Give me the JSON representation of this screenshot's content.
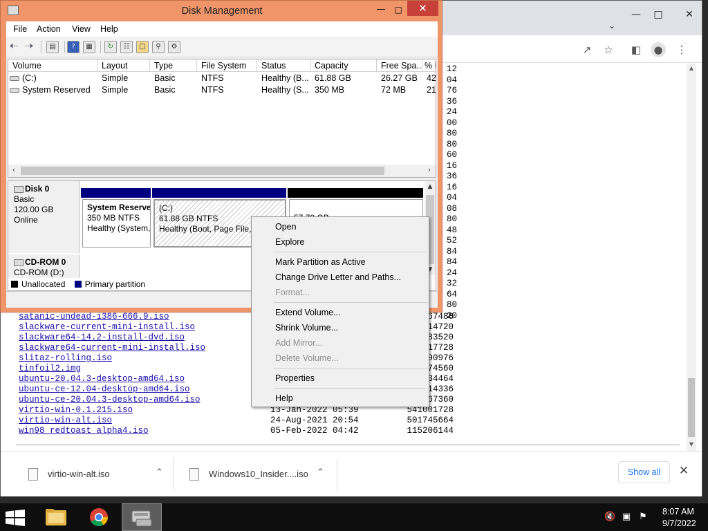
{
  "disk_management": {
    "title": "Disk Management",
    "menu": [
      "File",
      "Action",
      "View",
      "Help"
    ],
    "columns": [
      "Volume",
      "Layout",
      "Type",
      "File System",
      "Status",
      "Capacity",
      "Free Spa...",
      "% F"
    ],
    "volumes": [
      {
        "volume": "(C:)",
        "layout": "Simple",
        "type": "Basic",
        "fs": "NTFS",
        "status": "Healthy (B...",
        "capacity": "61.88 GB",
        "free": "26.27 GB",
        "pct": "42"
      },
      {
        "volume": "System Reserved",
        "layout": "Simple",
        "type": "Basic",
        "fs": "NTFS",
        "status": "Healthy (S...",
        "capacity": "350 MB",
        "free": "72 MB",
        "pct": "21"
      }
    ],
    "disk0": {
      "name": "Disk 0",
      "kind": "Basic",
      "size": "120.00 GB",
      "state": "Online",
      "partitions": [
        {
          "name": "System Reserve",
          "size": "350 MB NTFS",
          "status": "Healthy (System,"
        },
        {
          "name": "(C:)",
          "size": "61.88 GB NTFS",
          "status": "Healthy (Boot, Page File, P"
        },
        {
          "name": "",
          "size": "57.78 GB",
          "status": ""
        }
      ]
    },
    "cdrom": {
      "name": "CD-ROM 0",
      "label": "CD-ROM (D:)"
    },
    "legend": {
      "unallocated": "Unallocated",
      "primary": "Primary partition"
    },
    "colors": {
      "primary": "#000080",
      "unallocated": "#000000"
    }
  },
  "context_menu": {
    "items": [
      {
        "label": "Open",
        "enabled": true
      },
      {
        "label": "Explore",
        "enabled": true
      },
      {
        "label": "Mark Partition as Active",
        "enabled": true
      },
      {
        "label": "Change Drive Letter and Paths...",
        "enabled": true
      },
      {
        "label": "Format...",
        "enabled": false
      },
      {
        "label": "Extend Volume...",
        "enabled": true
      },
      {
        "label": "Shrink Volume...",
        "enabled": true
      },
      {
        "label": "Add Mirror...",
        "enabled": false
      },
      {
        "label": "Delete Volume...",
        "enabled": false
      },
      {
        "label": "Properties",
        "enabled": true
      },
      {
        "label": "Help",
        "enabled": true
      }
    ]
  },
  "browser": {
    "right_column_numbers": [
      "12",
      "04",
      "76",
      "36",
      "24",
      "00",
      "80",
      "80",
      "60",
      "16",
      "36",
      "16",
      "04",
      "08",
      "80",
      "48",
      "52",
      "84",
      "84",
      "24",
      "32",
      "64",
      "80",
      "20"
    ],
    "files": [
      {
        "name": "satanic-undead-i386-666.9.iso",
        "date": "",
        "size": "67488"
      },
      {
        "name": "slackware-current-mini-install.iso",
        "date": "",
        "size": "14720"
      },
      {
        "name": "slackware64-14.2-install-dvd.iso",
        "date": "",
        "size": "83520"
      },
      {
        "name": "slackware64-current-mini-install.iso",
        "date": "",
        "size": "17728"
      },
      {
        "name": "slitaz-rolling.iso",
        "date": "",
        "size": "90976"
      },
      {
        "name": "tinfoil2.img",
        "date": "",
        "size": "74560"
      },
      {
        "name": "ubuntu-20.04.3-desktop-amd64.iso",
        "date": "",
        "size": "34464"
      },
      {
        "name": "ubuntu-ce-12.04-desktop-amd64.iso",
        "date": "",
        "size": "14336"
      },
      {
        "name": "ubuntu-ce-20.04.3-desktop-amd64.iso",
        "date": "",
        "size": "67360"
      },
      {
        "name": "virtio-win-0.1.215.iso",
        "date": "13-Jan-2022 05:39",
        "size": "541001728"
      },
      {
        "name": "virtio-win-alt.iso",
        "date": "24-Aug-2021 20:54",
        "size": "501745664"
      },
      {
        "name": "win98_redtoast_alpha4.iso",
        "date": "05-Feb-2022 04:42",
        "size": "115206144"
      }
    ],
    "downloads": [
      {
        "name": "virtio-win-alt.iso"
      },
      {
        "name": "Windows10_Insider....iso"
      }
    ],
    "show_all": "Show all"
  },
  "taskbar": {
    "time": "8:07 AM",
    "date": "9/7/2022"
  }
}
